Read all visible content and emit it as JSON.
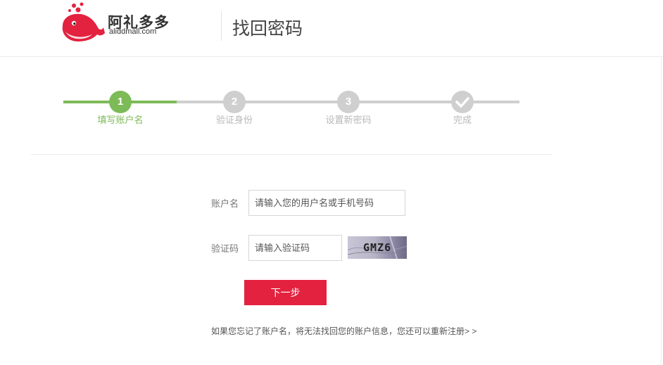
{
  "header": {
    "logo_cn": "阿礼多多",
    "logo_en": "aliddmall.com",
    "page_title": "找回密码",
    "brand_color": "#e3223f"
  },
  "steps": [
    {
      "number": "1",
      "label": "填写账户名",
      "state": "active"
    },
    {
      "number": "2",
      "label": "验证身份",
      "state": "todo"
    },
    {
      "number": "3",
      "label": "设置新密码",
      "state": "todo"
    },
    {
      "number": "✓",
      "label": "完成",
      "state": "todo"
    }
  ],
  "step_colors": {
    "active": "#7cbb57",
    "todo": "#cfcfcf"
  },
  "form": {
    "account_label": "账户名",
    "account_placeholder": "请输入您的用户名或手机号码",
    "account_value": "",
    "captcha_label": "验证码",
    "captcha_placeholder": "请输入验证码",
    "captcha_value": "",
    "captcha_image_text": "GMZ6",
    "next_button": "下一步"
  },
  "hint": {
    "text": "如果您忘记了账户名，将无法找回您的账户信息，您还可以",
    "link": "重新注册",
    "arrows": "> >"
  }
}
